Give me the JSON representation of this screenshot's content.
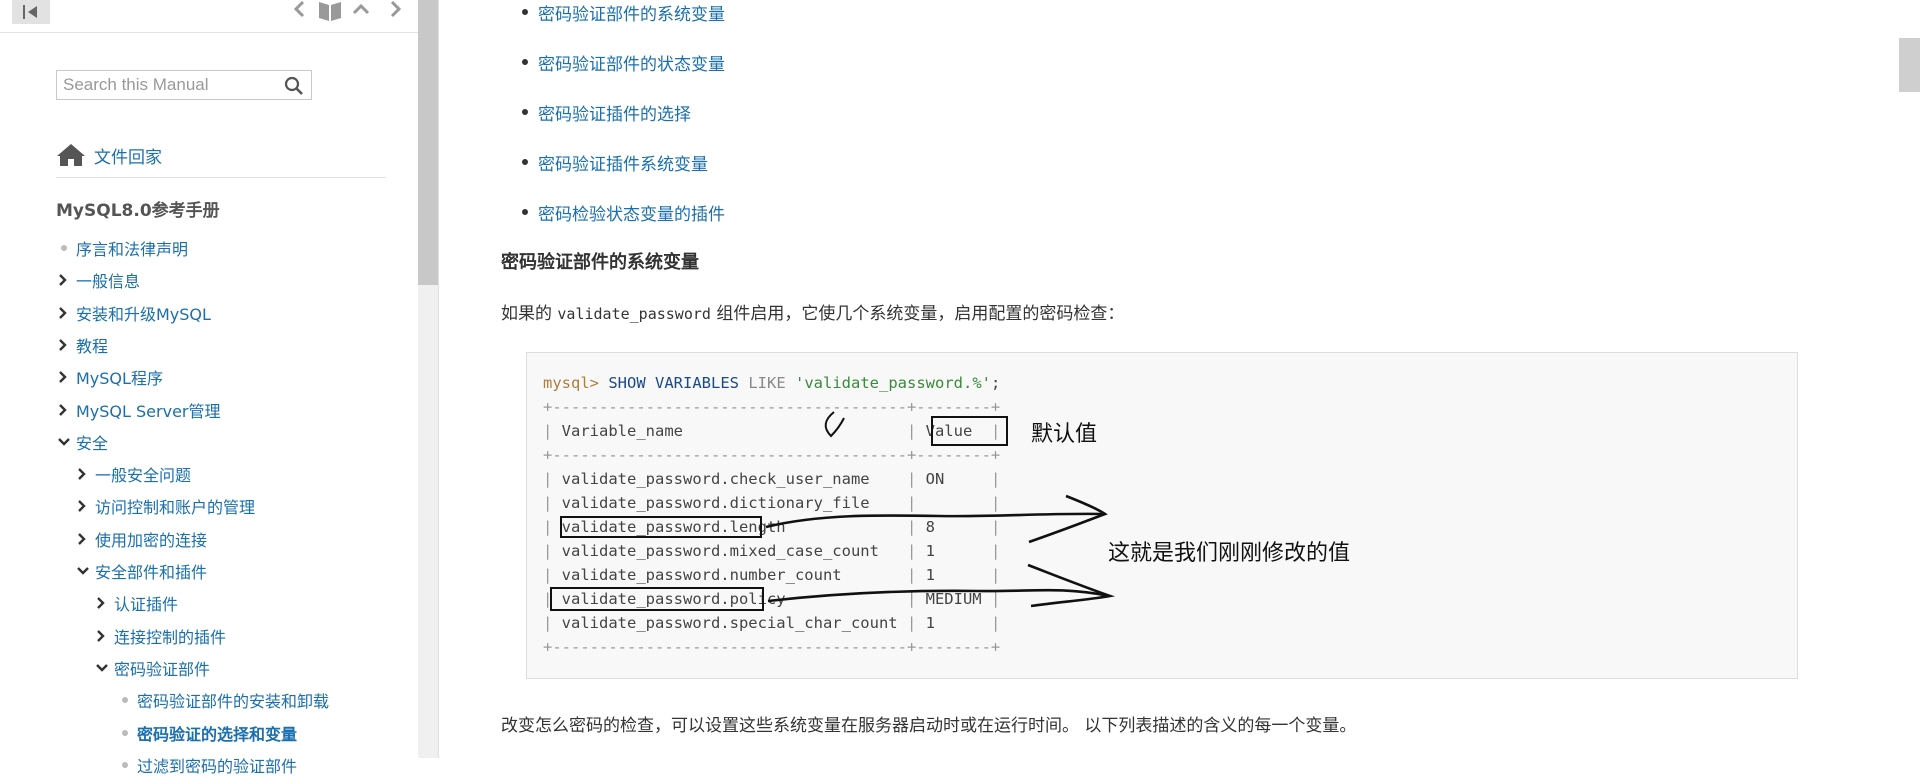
{
  "sidebar": {
    "search": {
      "placeholder": "Search this Manual"
    },
    "home_label": "文件回家",
    "manual_title": "MySQL8.0参考手册",
    "toc": [
      {
        "label": "序言和法律声明",
        "marker": "dot",
        "level": 0
      },
      {
        "label": "一般信息",
        "marker": "chevron-right",
        "level": 0
      },
      {
        "label": "安装和升级MySQL",
        "marker": "chevron-right",
        "level": 0
      },
      {
        "label": "教程",
        "marker": "chevron-right",
        "level": 0
      },
      {
        "label": "MySQL程序",
        "marker": "chevron-right",
        "level": 0
      },
      {
        "label": "MySQL Server管理",
        "marker": "chevron-right",
        "level": 0
      },
      {
        "label": "安全",
        "marker": "chevron-down",
        "level": 0
      },
      {
        "label": "一般安全问题",
        "marker": "chevron-right",
        "level": 1
      },
      {
        "label": "访问控制和账户的管理",
        "marker": "chevron-right",
        "level": 1
      },
      {
        "label": "使用加密的连接",
        "marker": "chevron-right",
        "level": 1
      },
      {
        "label": "安全部件和插件",
        "marker": "chevron-down",
        "level": 1
      },
      {
        "label": "认证插件",
        "marker": "chevron-right",
        "level": 2
      },
      {
        "label": "连接控制的插件",
        "marker": "chevron-right",
        "level": 2
      },
      {
        "label": "密码验证部件",
        "marker": "chevron-down",
        "level": 2
      },
      {
        "label": "密码验证部件的安装和卸载",
        "marker": "dot",
        "level": 3
      },
      {
        "label": "密码验证的选择和变量",
        "marker": "dot",
        "level": 3,
        "current": true
      },
      {
        "label": "过滤到密码的验证部件",
        "marker": "dot",
        "level": 3
      }
    ]
  },
  "content": {
    "links": [
      "密码验证部件的系统变量",
      "密码验证部件的状态变量",
      "密码验证插件的选择",
      "密码验证插件系统变量",
      "密码检验状态变量的插件"
    ],
    "section_title": "密码验证部件的系统变量",
    "intro_before": "如果的",
    "intro_code": "validate_password",
    "intro_after": "组件启用，它使几个系统变量，启用配置的密码检查：",
    "code": {
      "prompt": "mysql>",
      "keyword": "SHOW VARIABLES",
      "like": "LIKE",
      "string": "'validate_password.%'",
      "terminator": ";",
      "separator": "+--------------------------------------+--------+",
      "header_name": "Variable_name",
      "header_value": "Value",
      "rows": [
        {
          "name": "validate_password.check_user_name",
          "value": "ON"
        },
        {
          "name": "validate_password.dictionary_file",
          "value": ""
        },
        {
          "name": "validate_password.length",
          "value": "8"
        },
        {
          "name": "validate_password.mixed_case_count",
          "value": "1"
        },
        {
          "name": "validate_password.number_count",
          "value": "1"
        },
        {
          "name": "validate_password.policy",
          "value": "MEDIUM"
        },
        {
          "name": "validate_password.special_char_count",
          "value": "1"
        }
      ]
    },
    "annotations": {
      "default_value": "默认值",
      "modified_value": "这就是我们刚刚修改的值"
    },
    "closing_paragraph": "改变怎么密码的检查，可以设置这些系统变量在服务器启动时或在运行时间。 以下列表描述的含义的每一个变量。"
  },
  "colors": {
    "link": "#1a6fae",
    "code_bg": "#f8f8f8",
    "prompt": "#b07d3b",
    "string": "#3a8a3a"
  }
}
